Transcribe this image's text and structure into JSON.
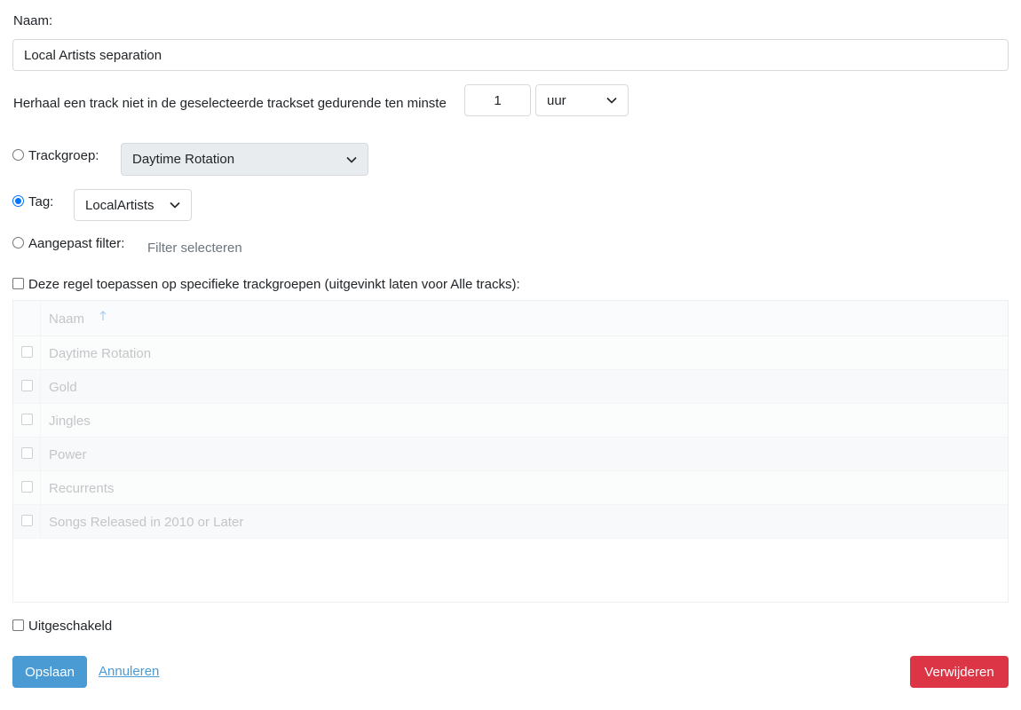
{
  "form": {
    "name_label": "Naam:",
    "name_value": "Local Artists separation",
    "repeat_label": "Herhaal een track niet in de geselecteerde trackset gedurende ten minste",
    "repeat_value": "1",
    "repeat_unit": "uur",
    "trackgroup_label": "Trackgroep:",
    "trackgroup_value": "Daytime Rotation",
    "tag_label": "Tag:",
    "tag_value": "LocalArtists",
    "custom_filter_label": "Aangepast filter:",
    "custom_filter_placeholder": "Filter selecteren",
    "selected_source": "tag",
    "apply_specific_label": "Deze regel toepassen op specifieke trackgroepen (uitgevinkt laten voor Alle tracks):",
    "apply_specific_checked": false,
    "disabled_label": "Uitgeschakeld",
    "disabled_checked": false
  },
  "table": {
    "header": "Naam",
    "sort_icon": "sort-up-arrow",
    "rows": [
      "Daytime Rotation",
      "Gold",
      "Jingles",
      "Power",
      "Recurrents",
      "Songs Released in 2010 or Later"
    ]
  },
  "actions": {
    "save_label": "Opslaan",
    "cancel_label": "Annuleren",
    "delete_label": "Verwijderen"
  },
  "colors": {
    "primary": "#4a9ad4",
    "danger": "#dc3545",
    "radio_accent": "#0075ff"
  }
}
